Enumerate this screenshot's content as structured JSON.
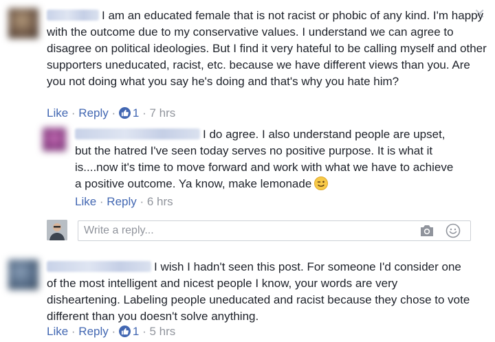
{
  "close_symbol": "✕",
  "comments": [
    {
      "text": "I am an educated female that is not racist or phobic of any kind. I'm happy with the outcome due to my conservative values. I understand we can agree to disagree on political ideologies. But I find it very hateful to be calling myself and other supporters uneducated, racist, etc. because we have different views than you. Are you not doing what you say he's doing and that's why you hate him?",
      "like_label": "Like",
      "reply_label": "Reply",
      "separator": " · ",
      "likes_count": "1",
      "time": "7 hrs"
    },
    {
      "text": "I do agree. I also understand people are upset, but the hatred I've seen today serves no positive purpose. It is what it is....now it's time to move forward and work with what we have to achieve a positive outcome. Ya know, make lemonade",
      "emoji": "wink-emoji",
      "like_label": "Like",
      "reply_label": "Reply",
      "separator": " · ",
      "time": "6 hrs"
    },
    {
      "text": "I wish I hadn't seen this post. For someone I'd consider one of the most intelligent and nicest people I know, your words are very disheartening. Labeling people uneducated and racist because they chose to vote different than you doesn't solve anything.",
      "like_label": "Like",
      "reply_label": "Reply",
      "separator": " · ",
      "likes_count": "1",
      "time": "5 hrs"
    }
  ],
  "reply_box": {
    "placeholder": "Write a reply..."
  },
  "icons": {
    "camera": "camera-icon",
    "emoji": "smiley-icon",
    "close": "close-icon",
    "like": "thumbs-up-icon"
  },
  "colors": {
    "link": "#4267b2",
    "meta": "#90949c",
    "text": "#1d2129"
  }
}
